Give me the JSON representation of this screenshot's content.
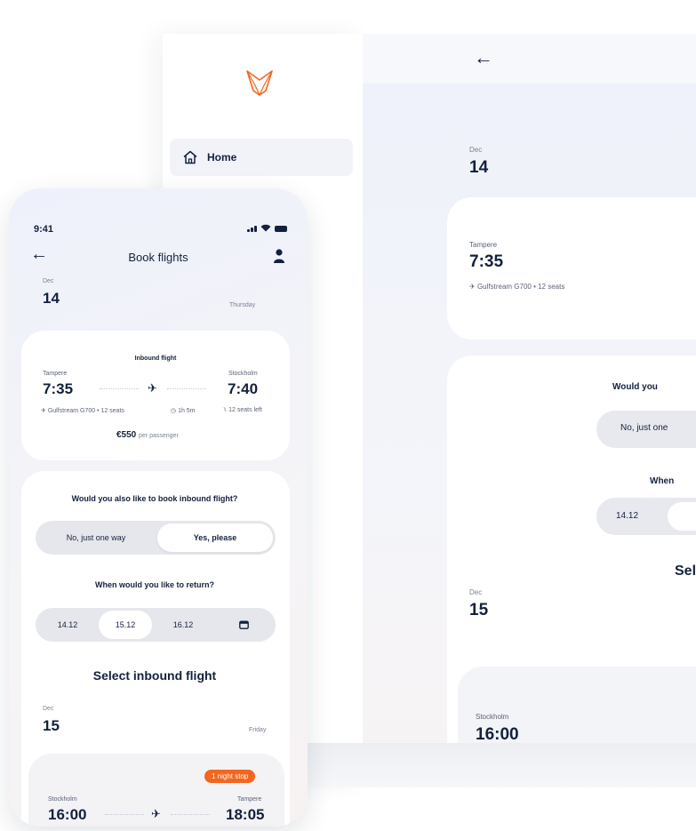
{
  "colors": {
    "navy": "#14213d",
    "accent": "#f2661f",
    "muted": "#7a8196"
  },
  "desktop": {
    "nav": {
      "home_label": "Home",
      "home_icon": "home-icon"
    },
    "date1": {
      "month": "Dec",
      "day": "14"
    },
    "flight": {
      "from_city": "Tampere",
      "depart": "7:35",
      "aircraft": "Gulfstream G700 • 12 seats"
    },
    "question": "Would you",
    "toggle_option": "No, just one",
    "return_question": "When",
    "date_option": "14.12",
    "select_title": "Sele",
    "date2": {
      "month": "Dec",
      "day": "15"
    },
    "flight2": {
      "from_city": "Stockholm",
      "depart": "16:00"
    }
  },
  "phone": {
    "status": {
      "time": "9:41"
    },
    "header": {
      "title": "Book flights"
    },
    "date1": {
      "month": "Dec",
      "day": "14",
      "weekday": "Thursday"
    },
    "outbound": {
      "title": "Inbound flight",
      "from_city": "Tampere",
      "to_city": "Stockholm",
      "depart": "7:35",
      "arrive": "7:40",
      "aircraft": "Gulfstream G700 • 12 seats",
      "duration": "1h 5m",
      "seats_left": "12 seats left",
      "price": "€550",
      "price_suffix": "per passenger"
    },
    "inbound_question": "Would you also like to book inbound flight?",
    "toggle": {
      "option_one": "No, just one way",
      "option_two": "Yes, please",
      "selected": "Yes, please"
    },
    "return_question": "When would you like to return?",
    "return_dates": [
      "14.12",
      "15.12",
      "16.12"
    ],
    "return_selected": "15.12",
    "select_title": "Select inbound flight",
    "date2": {
      "month": "Dec",
      "day": "15",
      "weekday": "Friday"
    },
    "next_flight": {
      "badge": "1 night stop",
      "from_city": "Stockholm",
      "to_city": "Tampere",
      "depart": "16:00",
      "arrive": "18:05"
    }
  }
}
